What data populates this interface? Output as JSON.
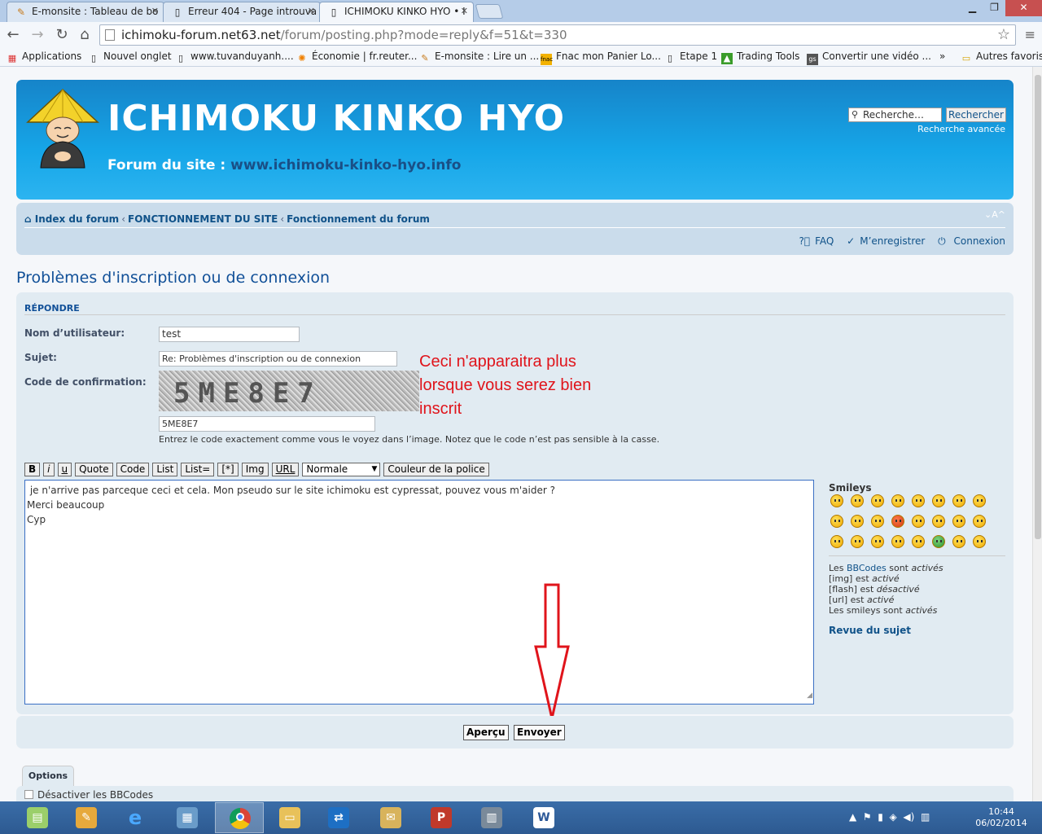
{
  "browser": {
    "tabs": [
      {
        "title": "E-monsite : Tableau de bo",
        "icon": "emonsite-icon"
      },
      {
        "title": "Erreur 404 - Page introuva",
        "icon": "page-icon"
      },
      {
        "title": "ICHIMOKU KINKO HYO • I",
        "icon": "page-icon",
        "active": true
      }
    ],
    "url_host": "ichimoku-forum.net63.net",
    "url_path": "/forum/posting.php?mode=reply&f=51&t=330",
    "bookmarks": [
      {
        "label": "Applications",
        "icon": "apps-grid-icon"
      },
      {
        "label": "Nouvel onglet",
        "icon": "page-icon"
      },
      {
        "label": "www.tuvanduyanh....",
        "icon": "page-icon"
      },
      {
        "label": "Économie | fr.reuter...",
        "icon": "reuters-icon"
      },
      {
        "label": "E-monsite : Lire un ...",
        "icon": "emonsite-icon"
      },
      {
        "label": "Fnac mon Panier Lo...",
        "icon": "fnac-icon"
      },
      {
        "label": "Etape 1",
        "icon": "page-icon"
      },
      {
        "label": "Trading Tools",
        "icon": "trading-icon"
      },
      {
        "label": "Convertir une vidéo ...",
        "icon": "gs-icon"
      },
      {
        "label": "»",
        "icon": ""
      },
      {
        "label": "Autres favoris",
        "icon": "folder-icon"
      }
    ]
  },
  "header": {
    "title": "ICHIMOKU KINKO HYO",
    "desc_prefix": "Forum du site : ",
    "desc_url": "www.ichimoku-kinko-hyo.info",
    "search_placeholder": "Recherche…",
    "search_button": "Rechercher",
    "advanced_search": "Recherche avancée"
  },
  "nav": {
    "crumbs": [
      "Index du forum",
      "FONCTIONNEMENT DU SITE",
      "Fonctionnement du forum"
    ],
    "sep": "‹",
    "font_size": "⌄A^",
    "faq": "FAQ",
    "register": "M’enregistrer",
    "login": "Connexion"
  },
  "topic_title": "Problèmes d'inscription ou de connexion",
  "form": {
    "section": "RÉPONDRE",
    "username_label": "Nom d’utilisateur:",
    "username_value": "test",
    "subject_label": "Sujet:",
    "subject_value": "Re: Problèmes d'inscription ou de connexion",
    "captcha_label": "Code de confirmation:",
    "captcha_image_text": "5ME8E7",
    "captcha_value": "5ME8E7",
    "captcha_hint": "Entrez le code exactement comme vous le voyez dans l’image. Notez que le code n’est pas sensible à la casse.",
    "annotation": "Ceci n'apparaitra plus lorsque vous serez bien inscrit",
    "bbcode_buttons": [
      "B",
      "i",
      "u",
      "Quote",
      "Code",
      "List",
      "List=",
      "[*]",
      "Img",
      "URL"
    ],
    "font_size_select": "Normale",
    "font_color_button": "Couleur de la police",
    "message_lines": [
      " je n'arrive pas parceque ceci et cela. Mon pseudo sur le site ichimoku est cypressat, pouvez vous m'aider ?",
      "Merci beaucoup",
      "Cyp"
    ],
    "preview_button": "Aperçu",
    "submit_button": "Envoyer"
  },
  "sidebar": {
    "smileys_title": "Smileys",
    "bbinfo": {
      "l1_pre": "Les ",
      "l1_link": "BBCodes",
      "l1_mid": " sont ",
      "l1_state": "activés",
      "l2_pre": "[img] est ",
      "l2_state": "activé",
      "l3_pre": "[flash] est ",
      "l3_state": "désactivé",
      "l4_pre": "[url] est ",
      "l4_state": "activé",
      "l5_pre": "Les smileys sont ",
      "l5_state": "activés"
    },
    "review": "Revue du sujet"
  },
  "options": {
    "tab": "Options",
    "disable_bbcode": "Désactiver les BBCodes"
  },
  "taskbar": {
    "apps": [
      "explorer-icon",
      "paint-icon",
      "internet-explorer-icon",
      "control-panel-icon",
      "chrome-icon",
      "file-explorer-icon",
      "teamviewer-icon",
      "outlook-icon",
      "powerpoint-icon",
      "server-icon",
      "word-icon"
    ],
    "time": "10:44",
    "date": "06/02/2014"
  }
}
